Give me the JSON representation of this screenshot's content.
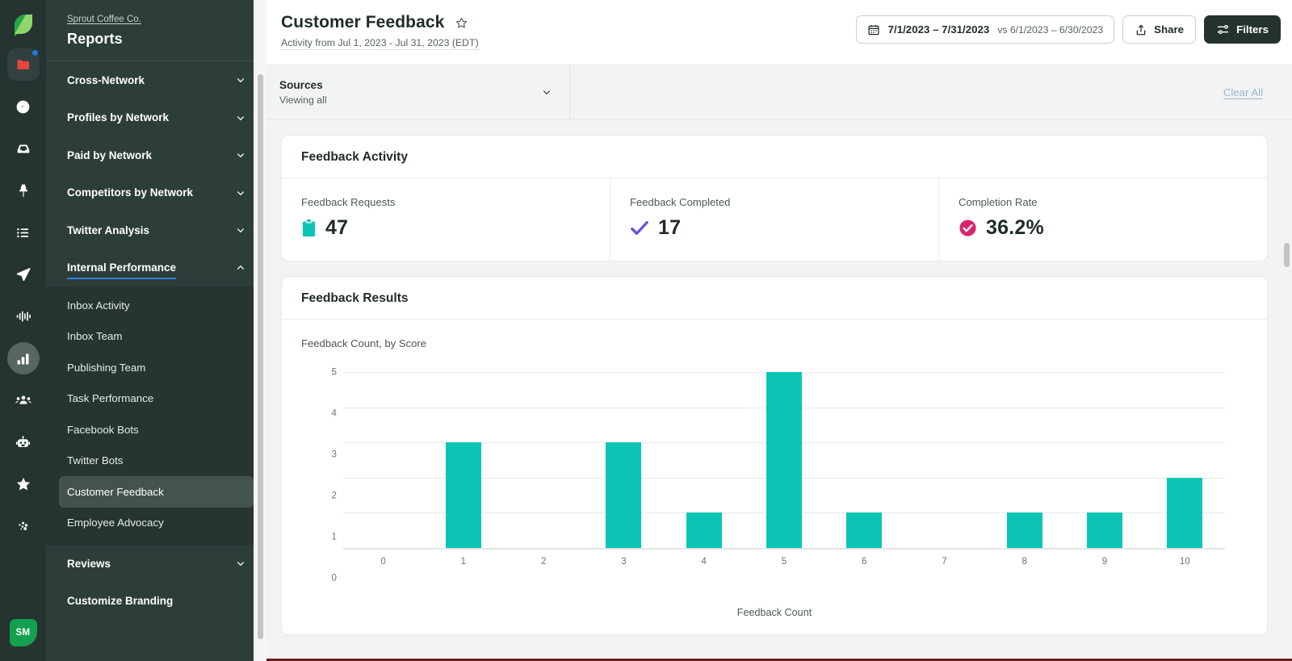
{
  "rail": {
    "logo": "sprout-leaf-logo",
    "items": [
      {
        "icon": "folder-icon",
        "name": "rail-item-folder",
        "badge": true,
        "boxed": true
      },
      {
        "icon": "speedometer-icon",
        "name": "rail-item-dashboard"
      },
      {
        "icon": "inbox-icon",
        "name": "rail-item-inbox"
      },
      {
        "icon": "pin-icon",
        "name": "rail-item-publishing"
      },
      {
        "icon": "list-icon",
        "name": "rail-item-tasks"
      },
      {
        "icon": "paper-plane-icon",
        "name": "rail-item-send"
      },
      {
        "icon": "audio-wave-icon",
        "name": "rail-item-listening"
      },
      {
        "icon": "bar-chart-icon",
        "name": "rail-item-reports",
        "active": true
      },
      {
        "icon": "people-icon",
        "name": "rail-item-employees"
      },
      {
        "icon": "robot-icon",
        "name": "rail-item-bots"
      },
      {
        "icon": "star-icon",
        "name": "rail-item-reviews"
      },
      {
        "icon": "dots-cluster-icon",
        "name": "rail-item-more"
      }
    ],
    "avatar_initials": "SM"
  },
  "sidebar": {
    "org": "Sprout Coffee Co.",
    "title": "Reports",
    "groups": [
      {
        "label": "Cross-Network",
        "expanded": false
      },
      {
        "label": "Profiles by Network",
        "expanded": false
      },
      {
        "label": "Paid by Network",
        "expanded": false
      },
      {
        "label": "Competitors by Network",
        "expanded": false
      },
      {
        "label": "Twitter Analysis",
        "expanded": false
      },
      {
        "label": "Internal Performance",
        "expanded": true
      }
    ],
    "internal_items": [
      {
        "label": "Inbox Activity",
        "selected": false
      },
      {
        "label": "Inbox Team",
        "selected": false
      },
      {
        "label": "Publishing Team",
        "selected": false
      },
      {
        "label": "Task Performance",
        "selected": false
      },
      {
        "label": "Facebook Bots",
        "selected": false
      },
      {
        "label": "Twitter Bots",
        "selected": false
      },
      {
        "label": "Customer Feedback",
        "selected": true
      },
      {
        "label": "Employee Advocacy",
        "selected": false
      }
    ],
    "groups_after": [
      {
        "label": "Reviews",
        "expanded": false
      },
      {
        "label": "Customize Branding",
        "expanded": false,
        "no_chevron": true
      }
    ]
  },
  "header": {
    "title": "Customer Feedback",
    "subtitle": "Activity from Jul 1, 2023 - Jul 31, 2023 (EDT)",
    "date_range": "7/1/2023 – 7/31/2023",
    "date_compare": "vs 6/1/2023 – 6/30/2023",
    "share_label": "Share",
    "filters_label": "Filters"
  },
  "filterbar": {
    "sources_label": "Sources",
    "sources_value": "Viewing all",
    "clear_all": "Clear All"
  },
  "activity_card": {
    "title": "Feedback Activity",
    "kpis": [
      {
        "label": "Feedback Requests",
        "value": "47",
        "icon": "clipboard-icon",
        "color": "#0cc5b4"
      },
      {
        "label": "Feedback Completed",
        "value": "17",
        "icon": "checkmark-icon",
        "color": "#6b4ee6"
      },
      {
        "label": "Completion Rate",
        "value": "36.2%",
        "icon": "check-circle-icon",
        "color": "#d6246e"
      }
    ]
  },
  "results_card": {
    "title": "Feedback Results",
    "subtitle": "Feedback Count, by Score"
  },
  "chart_data": {
    "type": "bar",
    "title": "Feedback Count, by Score",
    "categories": [
      "0",
      "1",
      "2",
      "3",
      "4",
      "5",
      "6",
      "7",
      "8",
      "9",
      "10"
    ],
    "values": [
      0,
      3,
      0,
      3,
      1,
      5,
      1,
      0,
      1,
      1,
      2
    ],
    "xlabel": "Feedback Count",
    "ylabel": "",
    "ylim": [
      0,
      5
    ],
    "yticks": [
      "5",
      "4",
      "3",
      "2",
      "1",
      "0"
    ],
    "grid": true,
    "legend": "none",
    "bar_color": "#0cc5b4"
  },
  "colors": {
    "rail_bg": "#253331",
    "nav_bg": "#2d3d3a",
    "nav_sub_bg": "#263432",
    "accent_teal": "#0cc5b4",
    "accent_blue": "#2f80ed",
    "dark_button": "#25332f"
  }
}
